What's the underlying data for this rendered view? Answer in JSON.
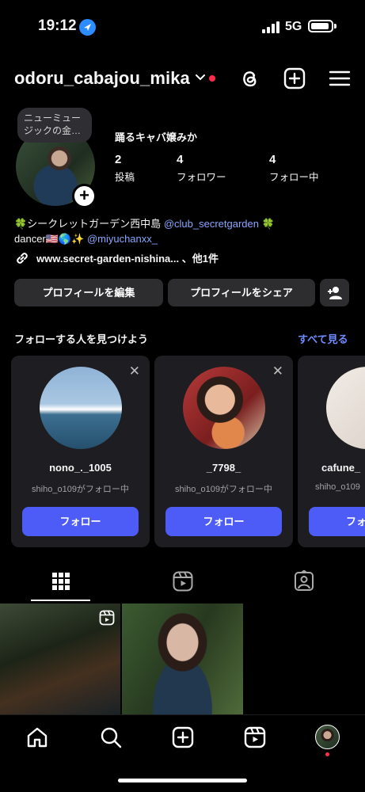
{
  "status_bar": {
    "time": "19:12",
    "network": "5G"
  },
  "header": {
    "username": "odoru_cabajou_mika"
  },
  "note": {
    "line1": "ニューミュー",
    "line2": "ジックの金…"
  },
  "profile": {
    "display_name": "踊るキャバ嬢みか",
    "stats": [
      {
        "count": "2",
        "label": "投稿"
      },
      {
        "count": "4",
        "label": "フォロワー"
      },
      {
        "count": "4",
        "label": "フォロー中"
      }
    ],
    "bio_line1_text": "🍀シークレットガーデン西中島",
    "bio_line1_mention": "@club_secretgarden",
    "bio_line1_end": "🍀",
    "bio_line2_text": "dancer🇺🇸🌎✨",
    "bio_line2_mention": "@miyuchanxx_",
    "link": "www.secret-garden-nishina... 、他1件"
  },
  "actions": {
    "edit": "プロフィールを編集",
    "share": "プロフィールをシェア"
  },
  "suggestions": {
    "title": "フォローする人を見つけよう",
    "see_all": "すべて見る",
    "cards": [
      {
        "name": "nono_._1005",
        "sub": "shiho_o109がフォロー中",
        "button": "フォロー"
      },
      {
        "name": "_7798_",
        "sub": "shiho_o109がフォロー中",
        "button": "フォロー"
      },
      {
        "name": "cafune_",
        "sub": "shiho_o109",
        "button": "フォ"
      }
    ]
  },
  "tabs": [
    "grid-icon",
    "reels-icon",
    "tagged-icon"
  ],
  "colors": {
    "accent": "#4e5cf7",
    "link": "#6f8bff",
    "notification": "#ff2d4b"
  }
}
